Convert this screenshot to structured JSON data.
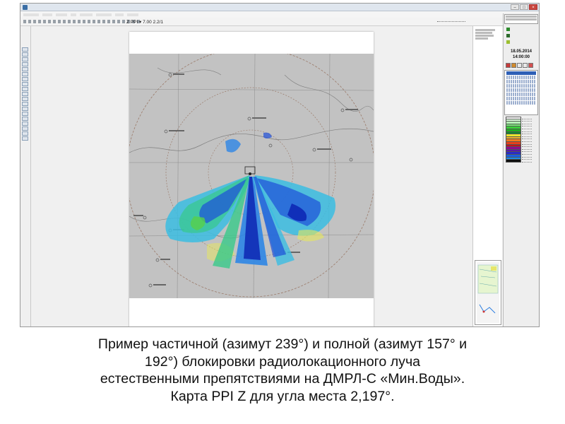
{
  "window": {
    "title": "",
    "buttons": [
      "–",
      "□",
      "×"
    ]
  },
  "toolbar": {
    "readout": "Z PPI ▾  7.00  2.2/1"
  },
  "side_panel": {
    "time_text": "18.05.2014\n14:00:00"
  },
  "caption": {
    "lines": [
      "Пример частичной (азимут 239°) и полной (азимут 157° и",
      "192°) блокировки радиолокационного луча",
      "естественными препятствиями на ДМРЛ-С «Мин.Воды».",
      "Карта PPI Z для угла места 2,197°."
    ]
  },
  "colors": {
    "map_background": "#c2c2c2",
    "page": "#ffffff",
    "window_chrome": "#f0f0f0",
    "echo_palette": [
      "#0a1fb0",
      "#1e4fd8",
      "#2e86e6",
      "#3bbde2",
      "#38c98a",
      "#57d04a",
      "#9be04a",
      "#e8e85a"
    ],
    "legend_palette": [
      "#ffffff",
      "#d9ffd9",
      "#b6f7b6",
      "#79e779",
      "#39d139",
      "#1fae1f",
      "#0f8a2f",
      "#e7e72f",
      "#f3b52a",
      "#f07a1f",
      "#e8401a",
      "#c0141a",
      "#8e0c8e",
      "#5a1aa8",
      "#2b2bc8",
      "#1a5fe0",
      "#1a8ae8",
      "#0f0f0f"
    ]
  },
  "icons": [
    "app-icon",
    "minimize-icon",
    "maximize-icon",
    "close-icon",
    "play-icon",
    "stop-icon",
    "radar-site-icon"
  ]
}
